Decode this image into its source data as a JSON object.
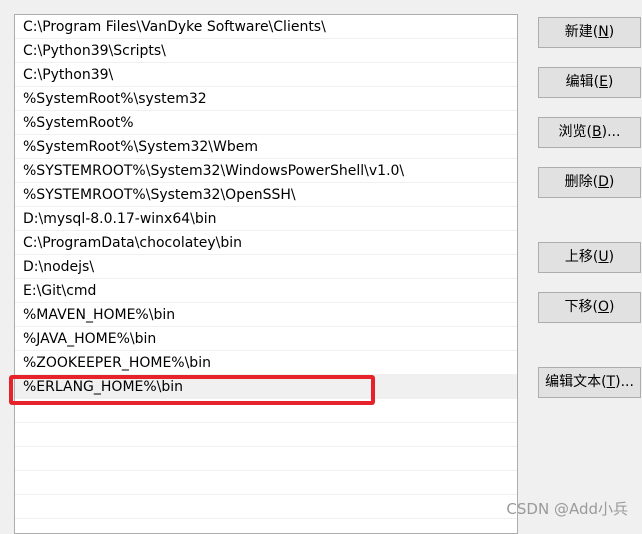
{
  "path_list": {
    "entries": [
      "C:\\Program Files\\VanDyke Software\\Clients\\",
      "C:\\Python39\\Scripts\\",
      "C:\\Python39\\",
      "%SystemRoot%\\system32",
      "%SystemRoot%",
      "%SystemRoot%\\System32\\Wbem",
      "%SYSTEMROOT%\\System32\\WindowsPowerShell\\v1.0\\",
      "%SYSTEMROOT%\\System32\\OpenSSH\\",
      "D:\\mysql-8.0.17-winx64\\bin",
      "C:\\ProgramData\\chocolatey\\bin",
      "D:\\nodejs\\",
      "E:\\Git\\cmd",
      "%MAVEN_HOME%\\bin",
      "%JAVA_HOME%\\bin",
      "%ZOOKEEPER_HOME%\\bin",
      "%ERLANG_HOME%\\bin"
    ],
    "selected_entry": "%ERLANG_HOME%\\bin"
  },
  "buttons": {
    "new": {
      "label": "新建(",
      "mnemonic": "N",
      "suffix": ")"
    },
    "edit": {
      "label": "编辑(",
      "mnemonic": "E",
      "suffix": ")"
    },
    "browse": {
      "label": "浏览(",
      "mnemonic": "B",
      "suffix": ")..."
    },
    "delete": {
      "label": "删除(",
      "mnemonic": "D",
      "suffix": ")"
    },
    "move_up": {
      "label": "上移(",
      "mnemonic": "U",
      "suffix": ")"
    },
    "move_down": {
      "label": "下移(",
      "mnemonic": "O",
      "suffix": ")"
    },
    "edit_text": {
      "label": "编辑文本(",
      "mnemonic": "T",
      "suffix": ")..."
    }
  },
  "watermark": "CSDN @Add小兵",
  "colors": {
    "highlight_border": "#e6222b",
    "selected_row": "#f0f0f0",
    "dialog_bg": "#f0f0f0"
  }
}
